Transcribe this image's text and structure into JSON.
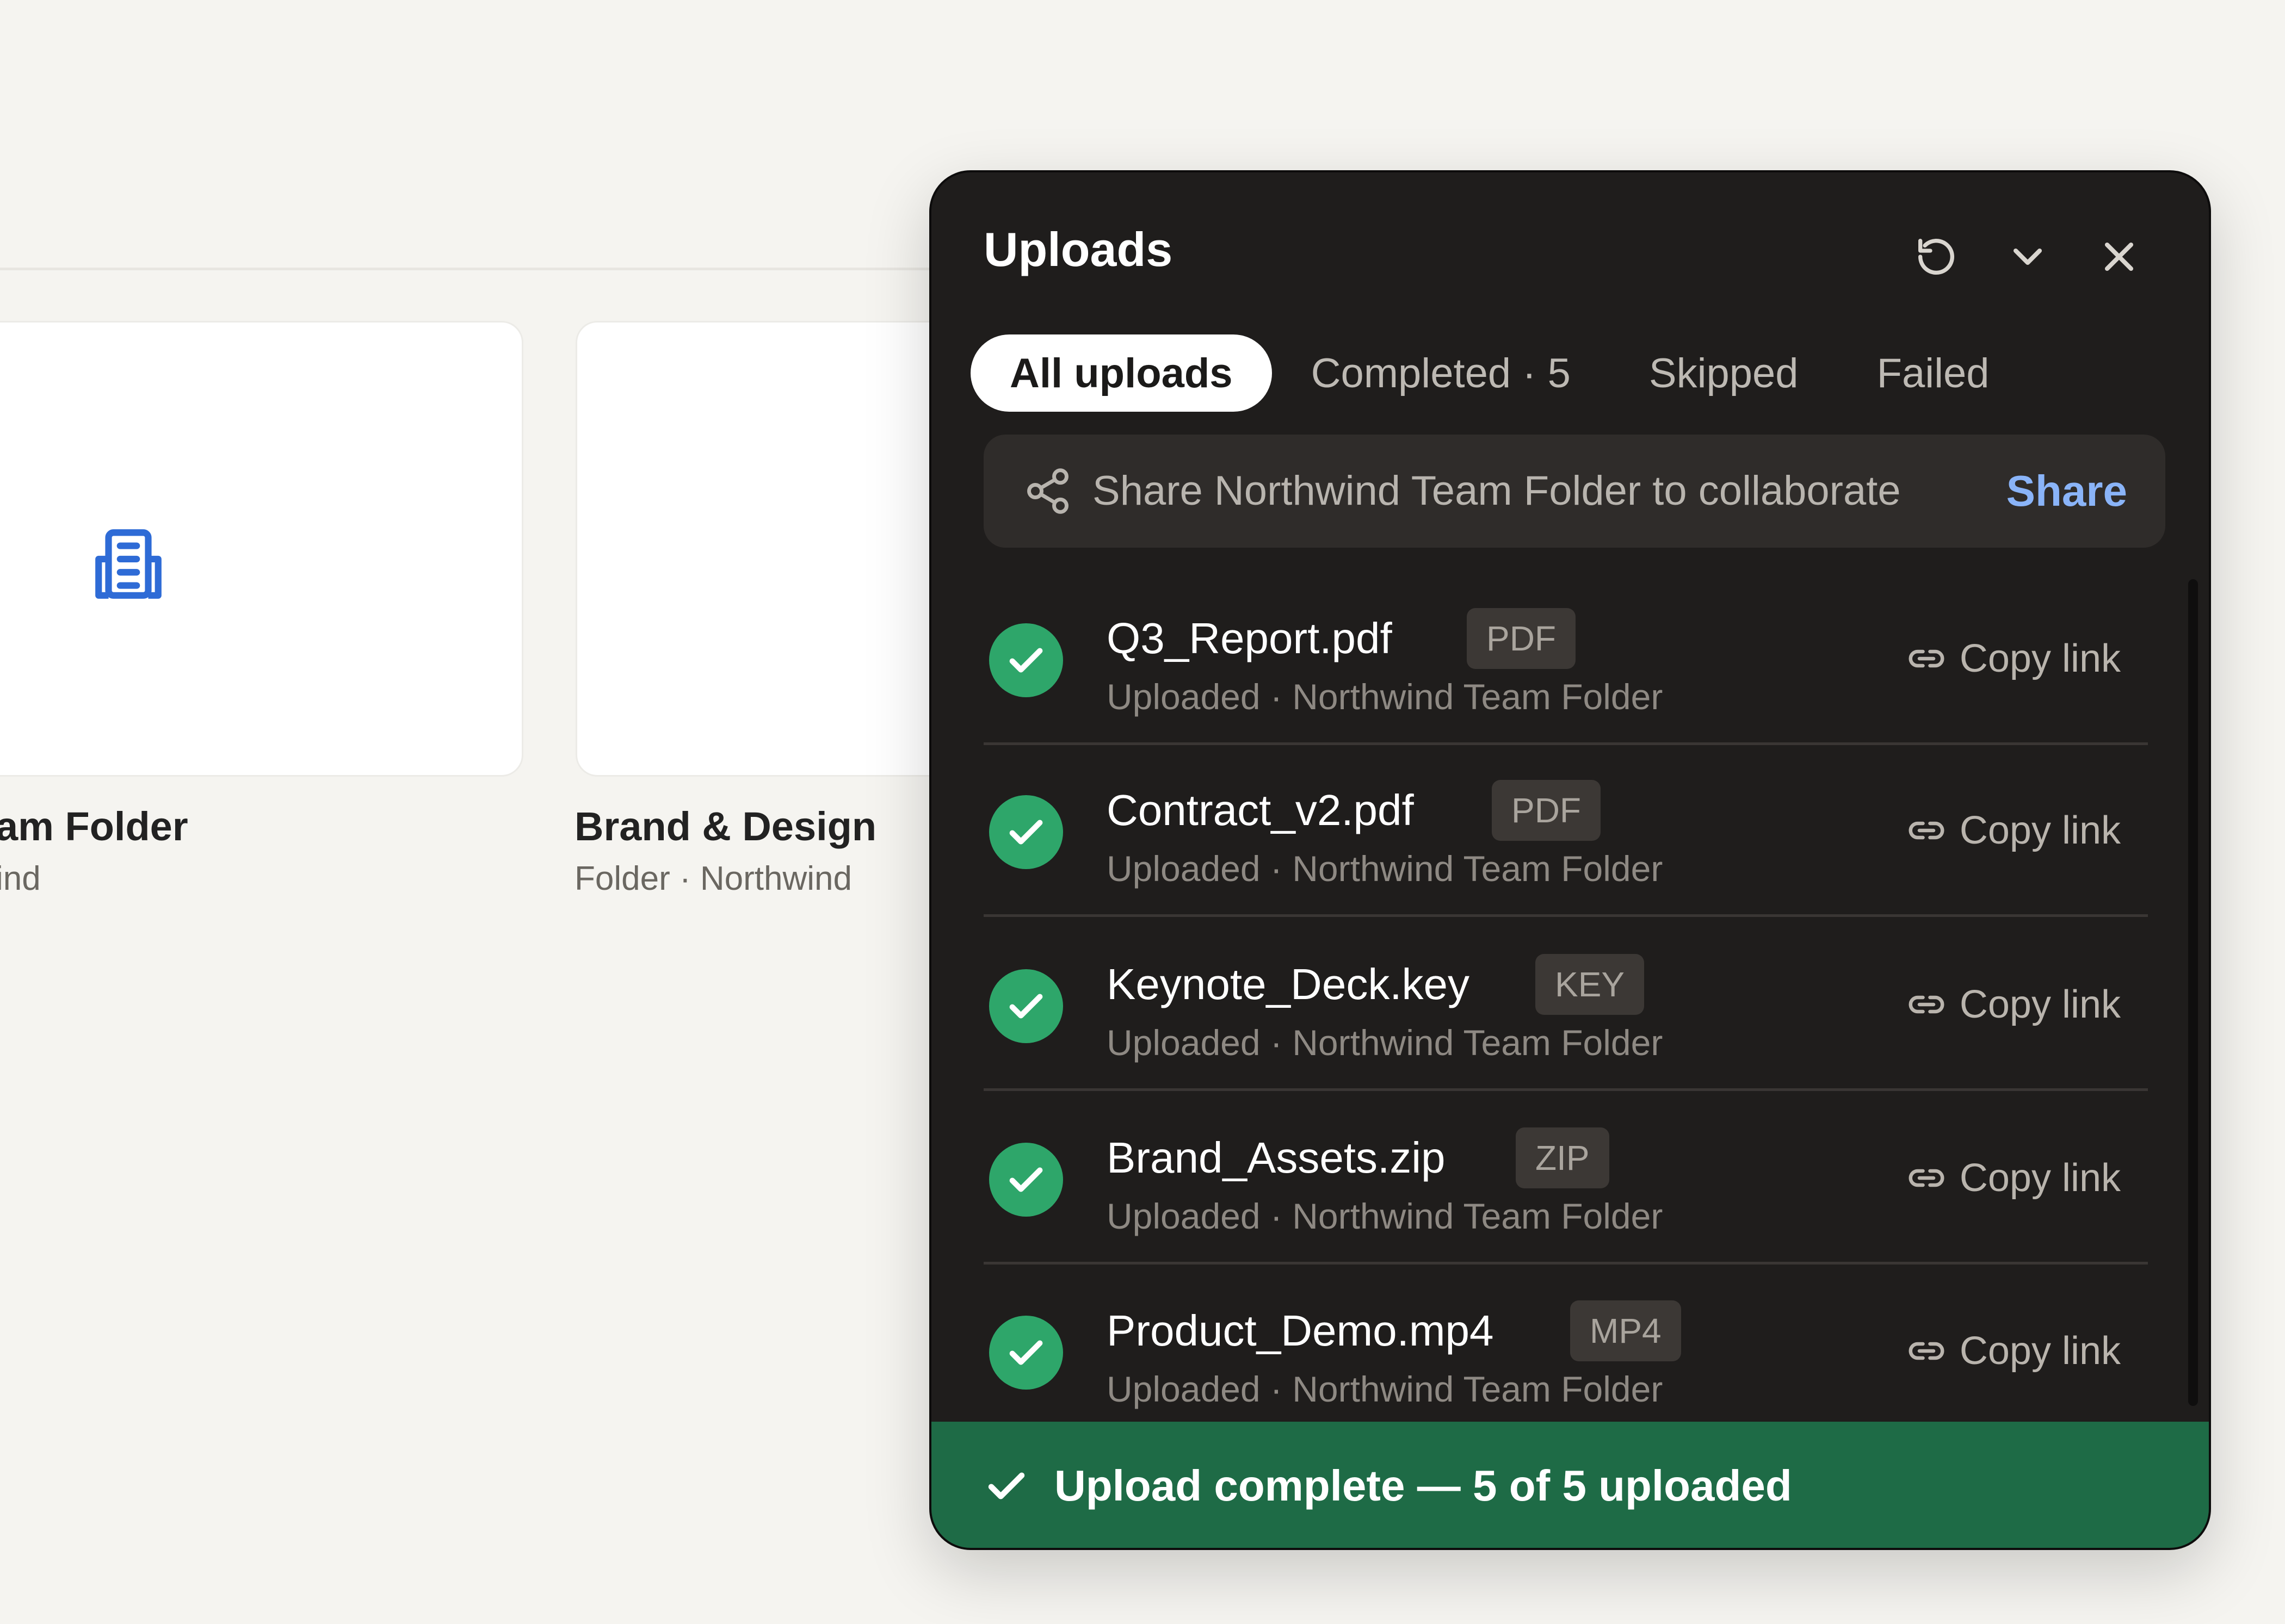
{
  "background": {
    "folders": [
      {
        "title": "am Folder",
        "subtitle": "ind",
        "icon": "building-icon"
      },
      {
        "title": "Brand & Design",
        "subtitle": "Folder · Northwind"
      }
    ]
  },
  "panel": {
    "title": "Uploads",
    "header_actions": [
      "retry-icon",
      "chevron-down-icon",
      "close-icon"
    ],
    "tabs": [
      {
        "label": "All uploads",
        "active": true
      },
      {
        "label": "Completed · 5",
        "active": false
      },
      {
        "label": "Skipped",
        "active": false
      },
      {
        "label": "Failed",
        "active": false
      }
    ],
    "share_bar": {
      "text": "Share Northwind Team Folder to collaborate",
      "action": "Share",
      "icon": "share-icon"
    },
    "uploads": [
      {
        "name": "Q3_Report.pdf",
        "type": "PDF",
        "meta": "Uploaded · Northwind Team Folder",
        "action": "Copy link",
        "status": "complete"
      },
      {
        "name": "Contract_v2.pdf",
        "type": "PDF",
        "meta": "Uploaded · Northwind Team Folder",
        "action": "Copy link",
        "status": "complete"
      },
      {
        "name": "Keynote_Deck.key",
        "type": "KEY",
        "meta": "Uploaded · Northwind Team Folder",
        "action": "Copy link",
        "status": "complete"
      },
      {
        "name": "Brand_Assets.zip",
        "type": "ZIP",
        "meta": "Uploaded · Northwind Team Folder",
        "action": "Copy link",
        "status": "complete"
      },
      {
        "name": "Product_Demo.mp4",
        "type": "MP4",
        "meta": "Uploaded · Northwind Team Folder",
        "action": "Copy link",
        "status": "complete"
      }
    ],
    "footer": {
      "text": "Upload complete — 5 of 5 uploaded",
      "icon": "check-icon"
    }
  },
  "colors": {
    "page_bg": "#f5f4f0",
    "panel_bg": "#1f1d1c",
    "success": "#2ea66a",
    "footer_bg": "#1e6b46",
    "link": "#8ab4f8",
    "folder_icon": "#2e6bd6"
  }
}
